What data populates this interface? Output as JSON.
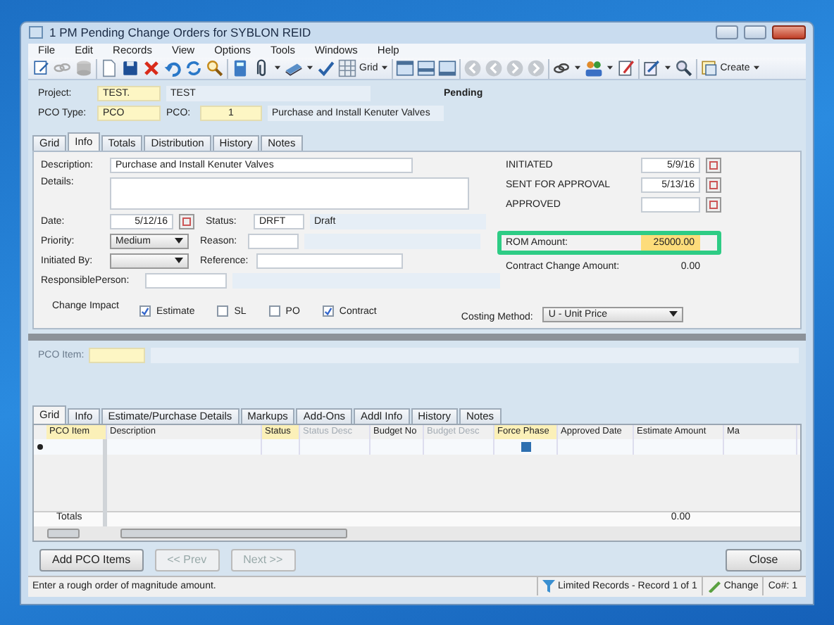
{
  "window": {
    "title": "1 PM Pending Change Orders for SYBLON REID"
  },
  "menu": [
    "File",
    "Edit",
    "Records",
    "View",
    "Options",
    "Tools",
    "Windows",
    "Help"
  ],
  "toolbar": {
    "grid_label": "Grid",
    "create_label": "Create"
  },
  "header": {
    "project_label": "Project:",
    "project_code": "TEST.",
    "project_name": "TEST",
    "status": "Pending",
    "pco_type_label": "PCO Type:",
    "pco_type": "PCO",
    "pco_label": "PCO:",
    "pco_number": "1",
    "pco_description": "Purchase and Install Kenuter Valves"
  },
  "tabs": [
    {
      "label": "Grid",
      "selected": false
    },
    {
      "label": "Info",
      "selected": true
    },
    {
      "label": "Totals",
      "selected": false
    },
    {
      "label": "Distribution",
      "selected": false
    },
    {
      "label": "History",
      "selected": false
    },
    {
      "label": "Notes",
      "selected": false
    }
  ],
  "info": {
    "description_label": "Description:",
    "description": "Purchase and Install Kenuter Valves",
    "details_label": "Details:",
    "date_label": "Date:",
    "date": "5/12/16",
    "status_label": "Status:",
    "status_code": "DRFT",
    "status_name": "Draft",
    "priority_label": "Priority:",
    "priority": "Medium",
    "reason_label": "Reason:",
    "initiated_by_label": "Initiated By:",
    "reference_label": "Reference:",
    "responsible_label": "ResponsiblePerson:",
    "change_impact_label": "Change Impact",
    "impacts": [
      {
        "label": "Estimate",
        "checked": true
      },
      {
        "label": "SL",
        "checked": false
      },
      {
        "label": "PO",
        "checked": false
      },
      {
        "label": "Contract",
        "checked": true
      }
    ],
    "costing_label": "Costing Method:",
    "costing_value": "U - Unit Price",
    "dates": [
      {
        "label": "INITIATED",
        "value": "5/9/16"
      },
      {
        "label": "SENT FOR APPROVAL",
        "value": "5/13/16"
      },
      {
        "label": "APPROVED"
      }
    ],
    "rom_label": "ROM Amount:",
    "rom_value": "25000.00",
    "rom_highlighted": true,
    "contract_label": "Contract Change Amount:",
    "contract_value": "0.00"
  },
  "pco_item_label": "PCO Item:",
  "grid_tabs": [
    {
      "label": "Grid",
      "selected": true
    },
    {
      "label": "Info",
      "selected": false
    },
    {
      "label": "Estimate/Purchase Details",
      "selected": false
    },
    {
      "label": "Markups",
      "selected": false
    },
    {
      "label": "Add-Ons",
      "selected": false
    },
    {
      "label": "Addl Info",
      "selected": false
    },
    {
      "label": "History",
      "selected": false
    },
    {
      "label": "Notes",
      "selected": false
    }
  ],
  "grid": {
    "frozen_column": {
      "label": "PCO Item",
      "highlighted": true
    },
    "columns": [
      {
        "label": "Description",
        "highlighted": false,
        "disabled": false
      },
      {
        "label": "Status",
        "highlighted": true,
        "disabled": false
      },
      {
        "label": "Status Desc",
        "highlighted": false,
        "disabled": true
      },
      {
        "label": "Budget No",
        "highlighted": false,
        "disabled": false
      },
      {
        "label": "Budget Desc",
        "highlighted": false,
        "disabled": true
      },
      {
        "label": "Force Phase",
        "highlighted": true,
        "disabled": false
      },
      {
        "label": "Approved Date",
        "highlighted": false,
        "disabled": false
      },
      {
        "label": "Estimate Amount",
        "highlighted": false,
        "disabled": false
      },
      {
        "label": "Ma",
        "highlighted": false,
        "disabled": false
      }
    ],
    "totals_label": "Totals",
    "estimate_total": "0.00"
  },
  "buttons": [
    {
      "label": "Add PCO Items",
      "disabled": false
    },
    {
      "label": "<< Prev",
      "disabled": true
    },
    {
      "label": "Next >>",
      "disabled": true
    }
  ],
  "close_label": "Close",
  "status_bar": {
    "message": "Enter a rough order of magnitude amount.",
    "records": "Limited Records - Record 1 of 1",
    "mode": "Change",
    "company": "Co#: 1"
  }
}
